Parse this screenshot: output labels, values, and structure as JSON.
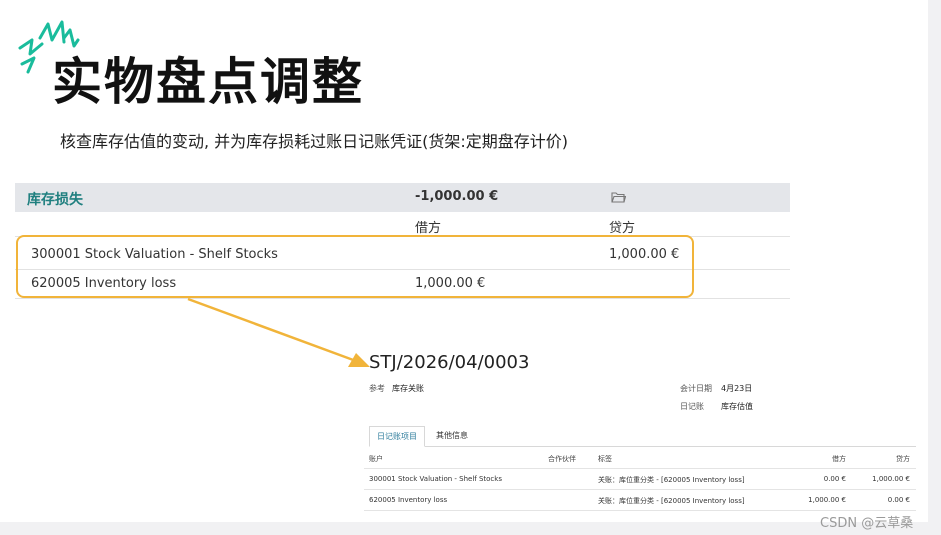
{
  "slide": {
    "title": "实物盘点调整",
    "subtitle": "核查库存估值的变动, 并为库存损耗过账日记账凭证(货架:定期盘存计价)"
  },
  "accounting_table": {
    "group_name": "库存损失",
    "group_amount": "-1,000.00 €",
    "debit_header": "借方",
    "credit_header": "贷方",
    "rows": [
      {
        "account": "300001 Stock Valuation - Shelf Stocks",
        "debit": "",
        "credit": "1,000.00 €"
      },
      {
        "account": "620005 Inventory loss",
        "debit": "1,000.00 €",
        "credit": ""
      }
    ]
  },
  "journal_entry": {
    "reference": "STJ/2026/04/0003",
    "ref_label": "参考",
    "ref_value": "库存关账",
    "date_label": "会计日期",
    "date_value": "4月23日",
    "journal_label": "日记账",
    "journal_value": "库存估值",
    "tabs": [
      "日记账项目",
      "其他信息"
    ],
    "headers": {
      "account": "账户",
      "partner": "合作伙伴",
      "label": "标签",
      "debit": "借方",
      "credit": "贷方"
    },
    "lines": [
      {
        "account": "300001 Stock Valuation - Shelf Stocks",
        "partner": "",
        "label": "关账：库位重分类 - [620005 Inventory loss]",
        "debit": "0.00 €",
        "credit": "1,000.00 €"
      },
      {
        "account": "620005 Inventory loss",
        "partner": "",
        "label": "关账：库位重分类 - [620005 Inventory loss]",
        "debit": "1,000.00 €",
        "credit": "0.00 €"
      }
    ]
  },
  "watermark": "CSDN @云草桑",
  "colors": {
    "accent_teal": "#1f7f7f",
    "highlight_orange": "#f1b43a",
    "spark_green": "#1abc9c"
  },
  "icons": {
    "folder": "folder-icon",
    "spark": "spark-decoration-icon",
    "arrow": "arrow-right-icon"
  }
}
